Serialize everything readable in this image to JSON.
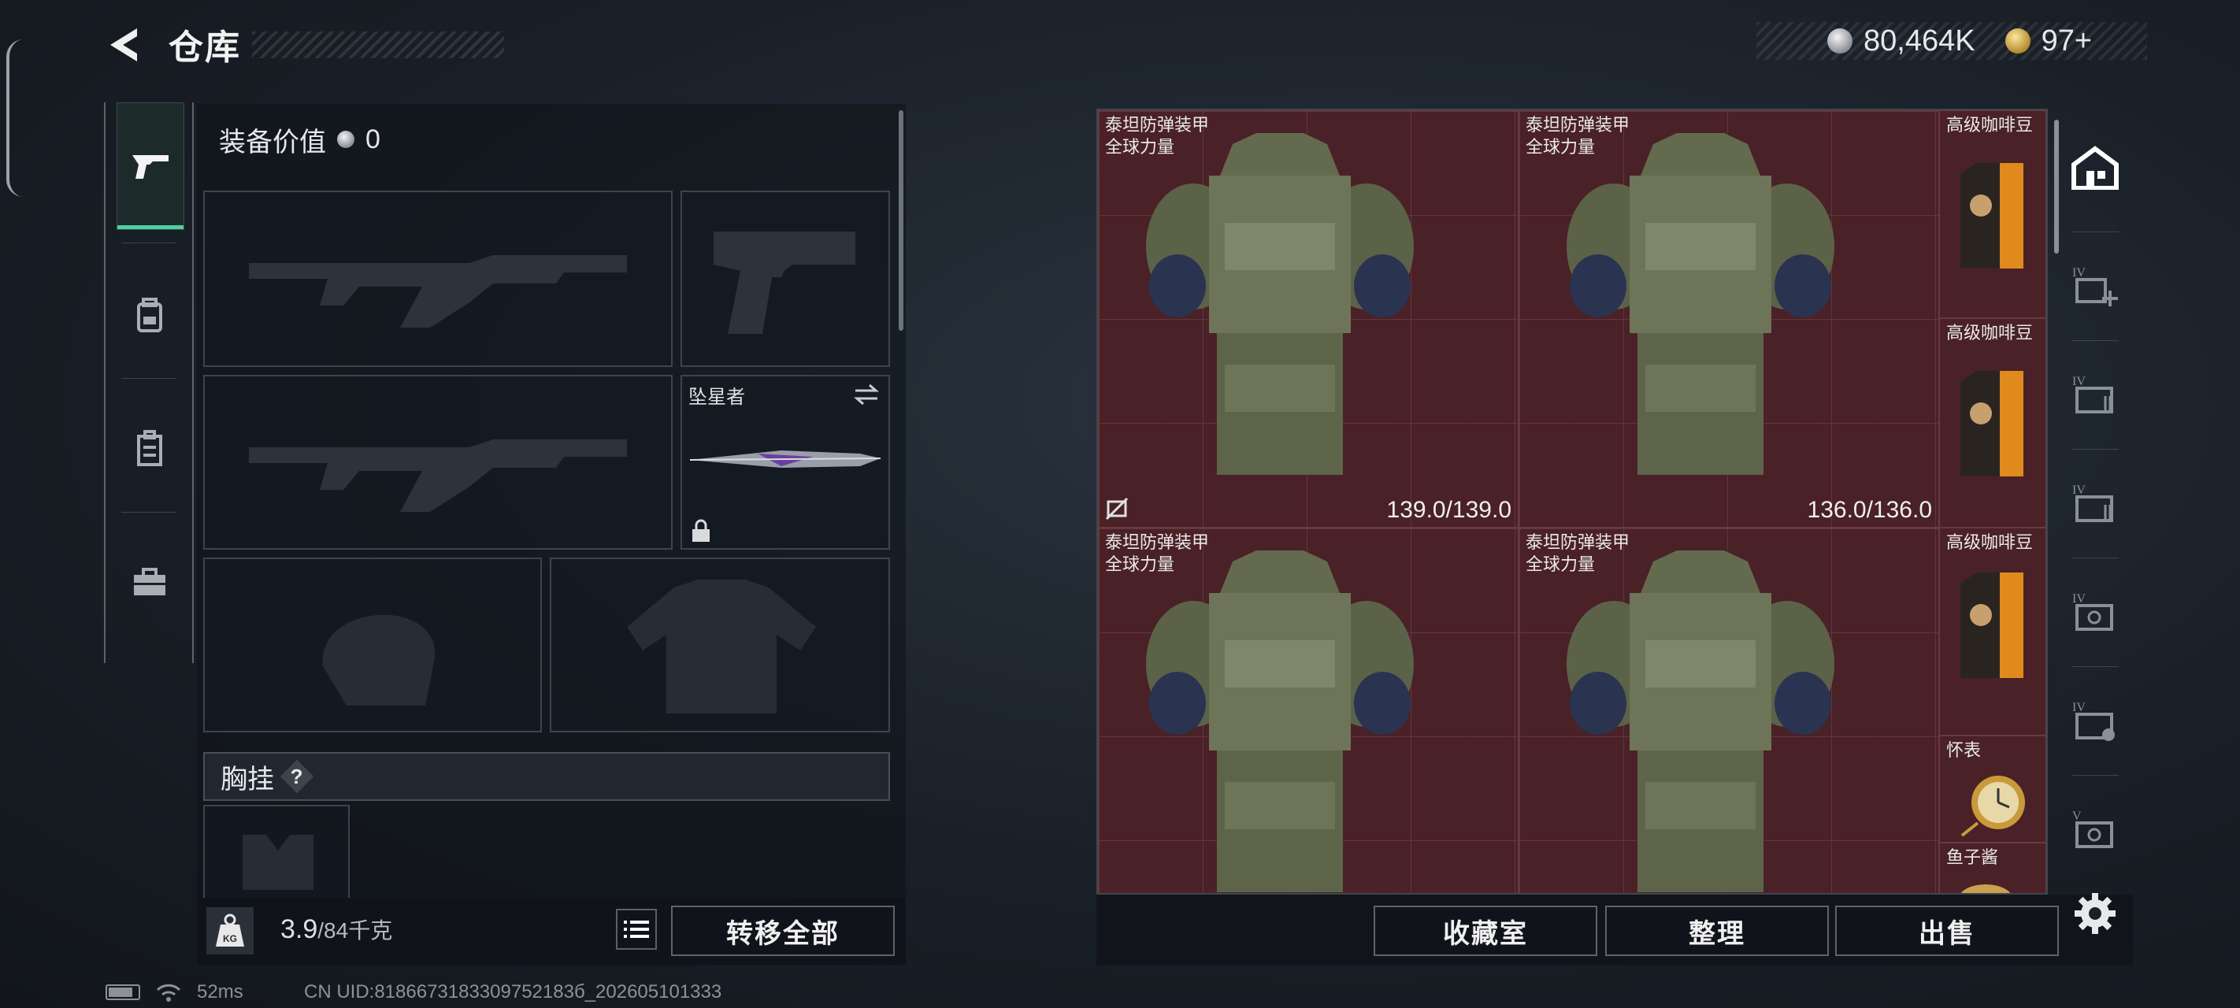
{
  "header": {
    "title": "仓库"
  },
  "currency": {
    "silver": "80,464K",
    "gold": "97+"
  },
  "tabs": [
    {
      "name": "weapons",
      "icon": "pistol-icon",
      "active": true
    },
    {
      "name": "backpack",
      "icon": "backpack-icon",
      "active": false
    },
    {
      "name": "locker",
      "icon": "locker-icon",
      "active": false
    },
    {
      "name": "case",
      "icon": "toolbox-icon",
      "active": false
    }
  ],
  "equipment": {
    "value_label": "装备价值",
    "value": "0",
    "melee_name": "坠星者",
    "chest_rig_label": "胸挂",
    "chest_rig_help": "?",
    "weight_current": "3.9",
    "weight_max": "/84千克",
    "transfer_all": "转移全部"
  },
  "storage": {
    "armor": [
      {
        "name": "泰坦防弹装甲",
        "sub": "全球力量",
        "durability": "139.0/139.0",
        "no_insure": true
      },
      {
        "name": "泰坦防弹装甲",
        "sub": "全球力量",
        "durability": "136.0/136.0",
        "no_insure": false
      },
      {
        "name": "泰坦防弹装甲",
        "sub": "全球力量",
        "durability": "",
        "no_insure": false
      },
      {
        "name": "泰坦防弹装甲",
        "sub": "全球力量",
        "durability": "",
        "no_insure": false
      }
    ],
    "side_items": [
      {
        "name": "高级咖啡豆",
        "icon": "coffee-bag-icon"
      },
      {
        "name": "高级咖啡豆",
        "icon": "coffee-bag-icon"
      },
      {
        "name": "高级咖啡豆",
        "icon": "coffee-bag-icon"
      },
      {
        "name": "怀表",
        "icon": "pocket-watch-icon"
      },
      {
        "name": "鱼子酱",
        "icon": "caviar-tin-icon"
      }
    ],
    "buttons": {
      "collection": "收藏室",
      "organize": "整理",
      "sell": "出售"
    }
  },
  "status": {
    "ping": "52ms",
    "uid": "CN UID:8186673183309752183б_202605101333"
  }
}
